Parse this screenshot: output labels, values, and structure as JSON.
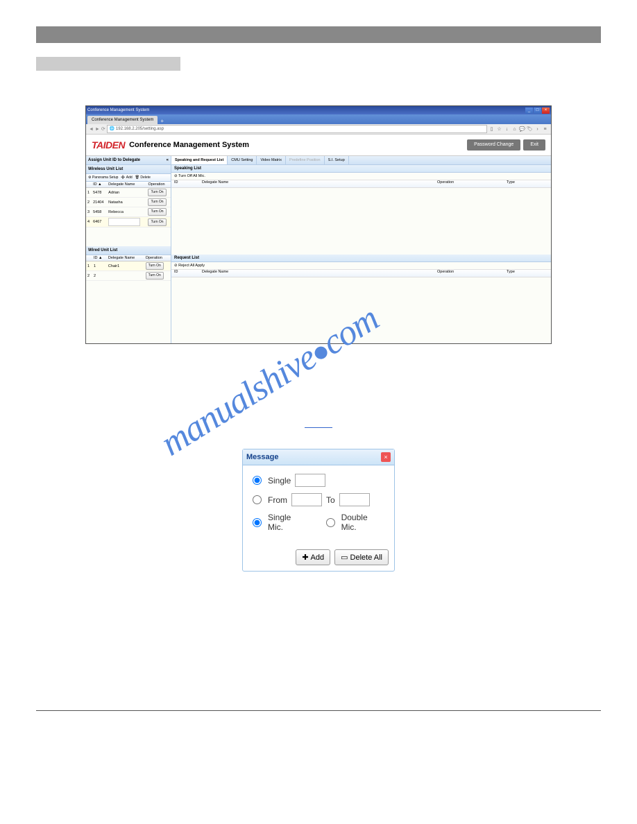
{
  "browser": {
    "windowTitle": "Conference Management System",
    "tabLabel": "Conference Management System",
    "url": "192.168.2.205/setting.asp"
  },
  "header": {
    "logo": "TAIDEN",
    "title": "Conference Management System",
    "passwordChange": "Password Change",
    "exit": "Exit"
  },
  "leftPanel": {
    "assignTitle": "Assign Unit ID to Delegate",
    "wirelessTitle": "Wireless Unit List",
    "panoramaSetup": "Panorama Setup",
    "add": "Add",
    "delete": "Delete",
    "cols": {
      "id": "ID ▲",
      "name": "Delegate Name",
      "op": "Operation"
    },
    "wirelessRows": [
      {
        "n": "1",
        "id": "5478",
        "name": "Adrian",
        "op": "Turn On"
      },
      {
        "n": "2",
        "id": "21404",
        "name": "Natasha",
        "op": "Turn On"
      },
      {
        "n": "3",
        "id": "5458",
        "name": "Rebecca",
        "op": "Turn On"
      },
      {
        "n": "4",
        "id": "6467",
        "name": "",
        "op": "Turn On"
      }
    ],
    "wiredTitle": "Wired Unit List",
    "wiredRows": [
      {
        "n": "1",
        "id": "1",
        "name": "Chair1",
        "op": "Turn On"
      },
      {
        "n": "2",
        "id": "2",
        "name": "",
        "op": "Turn On"
      }
    ]
  },
  "rightPanel": {
    "tabs": [
      "Speaking and Request List",
      "CMU Setting",
      "Video Matrix",
      "Predefine Position",
      "S.I. Setup"
    ],
    "speakingTitle": "Speaking List",
    "turnOffAll": "Turn Off All Mic.",
    "cols": {
      "id": "ID",
      "name": "Delegate Name",
      "op": "Operation",
      "type": "Type"
    },
    "requestTitle": "Request List",
    "rejectAll": "Reject All Apply"
  },
  "dialog": {
    "title": "Message",
    "single": "Single",
    "from": "From",
    "to": "To",
    "singleMic": "Single Mic.",
    "doubleMic": "Double Mic.",
    "add": "Add",
    "deleteAll": "Delete All"
  },
  "watermark": "manualshive.com"
}
